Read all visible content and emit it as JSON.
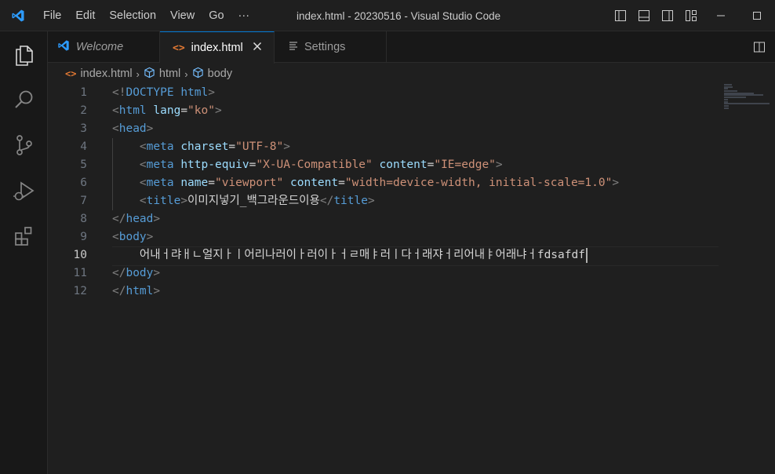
{
  "titlebar": {
    "menu": [
      "File",
      "Edit",
      "Selection",
      "View",
      "Go",
      "···"
    ],
    "window_title": "index.html - 20230516 - Visual Studio Code"
  },
  "tabs": [
    {
      "label": "Welcome",
      "icon": "vscode-logo-icon"
    },
    {
      "label": "index.html",
      "icon": "html-file-icon"
    },
    {
      "label": "Settings",
      "icon": "settings-list-icon"
    }
  ],
  "breadcrumb": {
    "file": "index.html",
    "items": [
      "html",
      "body"
    ]
  },
  "editor": {
    "current_line": 10,
    "lines": [
      {
        "n": "1",
        "text": "<!DOCTYPE html>"
      },
      {
        "n": "2",
        "text": "<html lang=\"ko\">"
      },
      {
        "n": "3",
        "text": "<head>"
      },
      {
        "n": "4",
        "text": "    <meta charset=\"UTF-8\">"
      },
      {
        "n": "5",
        "text": "    <meta http-equiv=\"X-UA-Compatible\" content=\"IE=edge\">"
      },
      {
        "n": "6",
        "text": "    <meta name=\"viewport\" content=\"width=device-width, initial-scale=1.0\">"
      },
      {
        "n": "7",
        "text": "    <title>이미지넣기_백그라운드이용</title>"
      },
      {
        "n": "8",
        "text": "</head>"
      },
      {
        "n": "9",
        "text": "<body>"
      },
      {
        "n": "10",
        "text": "    어내ㅓ랴ㅐㄴ얼지ㅏㅣ어리나러이ㅏ러이ㅏㅓㄹ매ㅑ러ㅣ다ㅓ래쟈ㅓ리어내ㅑ어래냐ㅓfdsafdf"
      },
      {
        "n": "11",
        "text": "</body>"
      },
      {
        "n": "12",
        "text": "</html>"
      }
    ]
  },
  "colors": {
    "accent": "#0078d4",
    "tag": "#569cd6",
    "attr": "#9cdcfe",
    "string": "#ce9178"
  }
}
